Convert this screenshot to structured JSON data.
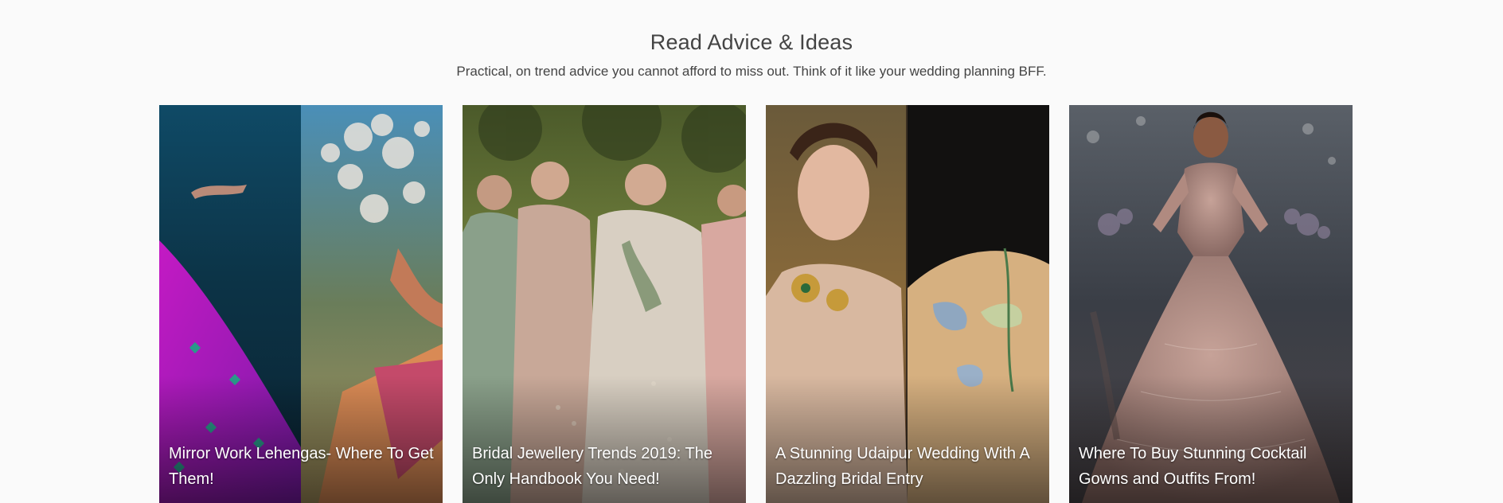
{
  "section": {
    "title": "Read Advice & Ideas",
    "subtitle": "Practical, on trend advice you cannot afford to miss out. Think of it like your wedding planning BFF."
  },
  "cards": [
    {
      "title": "Mirror Work Lehengas- Where To Get Them!",
      "image": "split-image-mirror-work-lehenga-and-mehendi-hands"
    },
    {
      "title": "Bridal Jewellery Trends 2019: The Only Handbook You Need!",
      "image": "group-of-bridesmaids-in-lehengas"
    },
    {
      "title": "A Stunning Udaipur Wedding With A Dazzling Bridal Entry",
      "image": "split-image-bride-portrait-and-embroidered-elephant"
    },
    {
      "title": "Where To Buy Stunning Cocktail Gowns and Outfits From!",
      "image": "model-on-runway-in-cocktail-gown"
    }
  ]
}
